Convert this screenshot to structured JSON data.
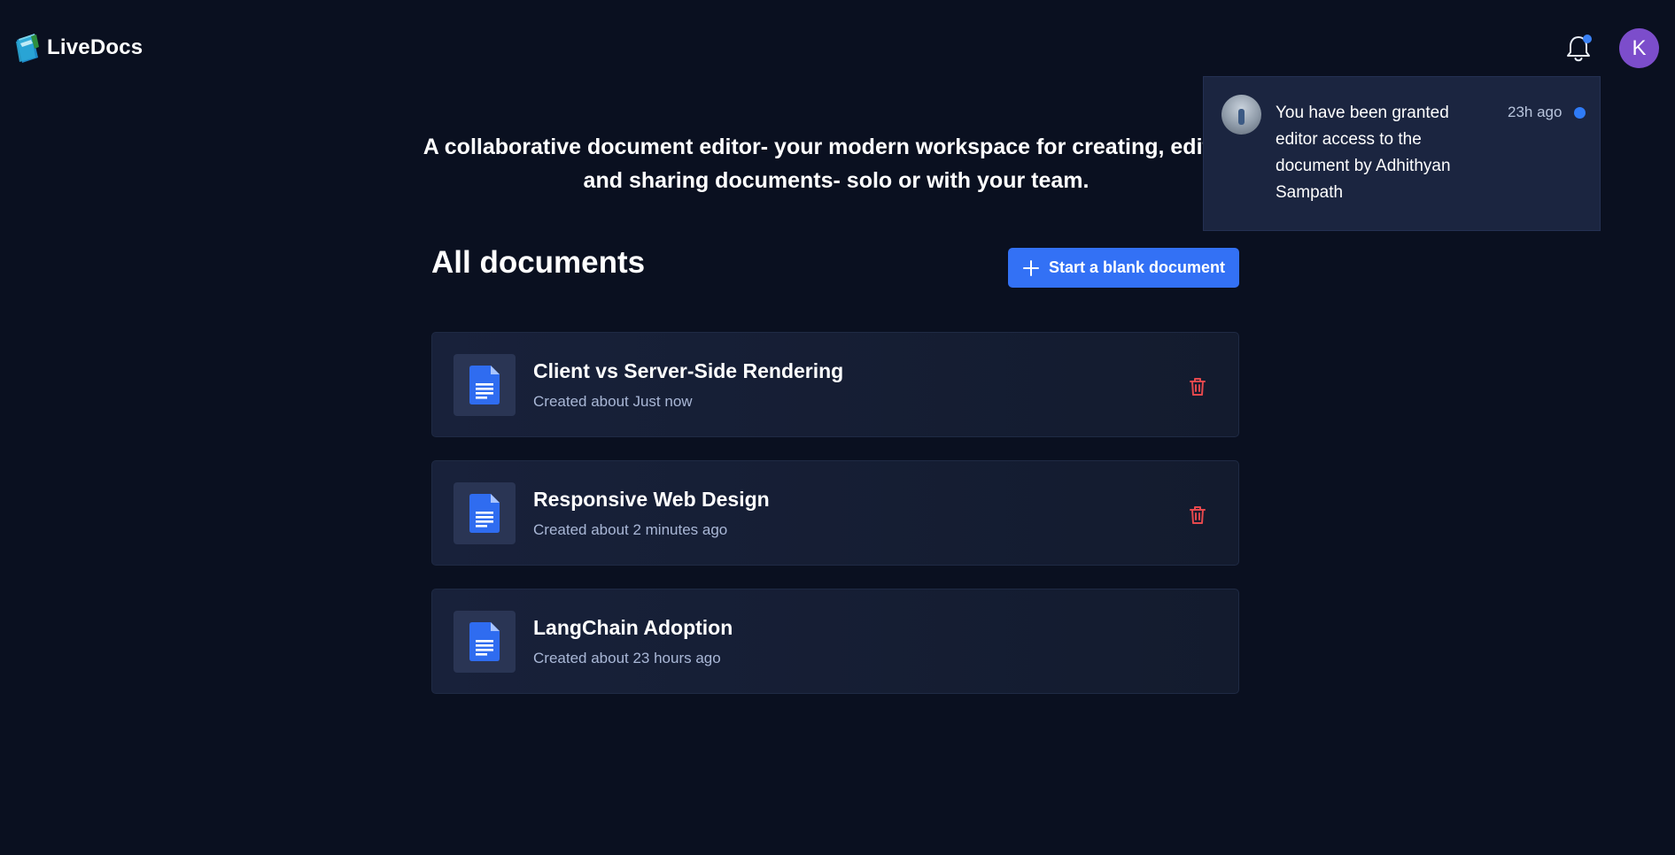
{
  "app": {
    "name": "LiveDocs"
  },
  "header": {
    "avatar_initial": "K",
    "has_unread": true
  },
  "notification": {
    "message": "You have been granted editor access to the document by Adhithyan Sampath",
    "time": "23h ago",
    "unread": true
  },
  "tagline": "A collaborative document editor- your modern workspace for creating, editing, and sharing documents- solo or with your team.",
  "section": {
    "title": "All documents",
    "new_button_label": "Start a blank document"
  },
  "documents": [
    {
      "title": "Client vs Server-Side Rendering",
      "created": "Created about Just now",
      "deletable": true
    },
    {
      "title": "Responsive Web Design",
      "created": "Created about 2 minutes ago",
      "deletable": true
    },
    {
      "title": "LangChain Adoption",
      "created": "Created about 23 hours ago",
      "deletable": false
    }
  ],
  "colors": {
    "background": "#0a1020",
    "accent": "#3371f5",
    "avatar": "#7c4dcb",
    "delete": "#e5484d",
    "doc_icon": "#2f6cf0"
  },
  "icons": {
    "logo": "livedocs-logo-icon",
    "bell": "bell-icon",
    "plus": "plus-icon",
    "document": "document-icon",
    "trash": "trash-icon"
  }
}
